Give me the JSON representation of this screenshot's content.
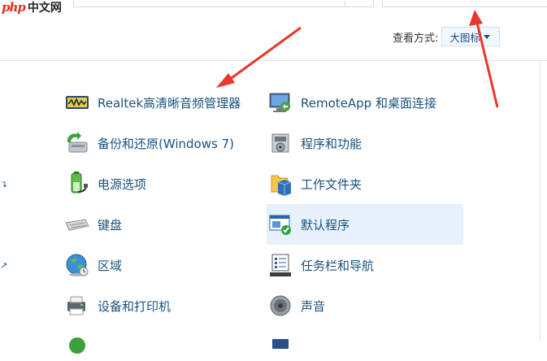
{
  "logo": {
    "mark": "php",
    "text": "中文网"
  },
  "view": {
    "label": "查看方式:",
    "value": "大图标"
  },
  "items_left": [
    {
      "label": "Realtek高清晰音频管理器",
      "icon": "audio-manager-icon"
    },
    {
      "label": "备份和还原(Windows 7)",
      "icon": "backup-restore-icon"
    },
    {
      "label": "电源选项",
      "icon": "power-options-icon"
    },
    {
      "label": "键盘",
      "icon": "keyboard-icon"
    },
    {
      "label": "区域",
      "icon": "region-globe-icon"
    },
    {
      "label": "设备和打印机",
      "icon": "devices-printers-icon"
    }
  ],
  "items_right": [
    {
      "label": "RemoteApp 和桌面连接",
      "icon": "remoteapp-icon"
    },
    {
      "label": "程序和功能",
      "icon": "programs-features-icon"
    },
    {
      "label": "工作文件夹",
      "icon": "work-folders-icon"
    },
    {
      "label": "默认程序",
      "icon": "default-programs-icon"
    },
    {
      "label": "任务栏和导航",
      "icon": "taskbar-navigation-icon"
    },
    {
      "label": "声音",
      "icon": "sound-icon"
    }
  ],
  "colors": {
    "link": "#19527e",
    "highlight": "#e6f1fb",
    "arrow": "#e8372b"
  }
}
